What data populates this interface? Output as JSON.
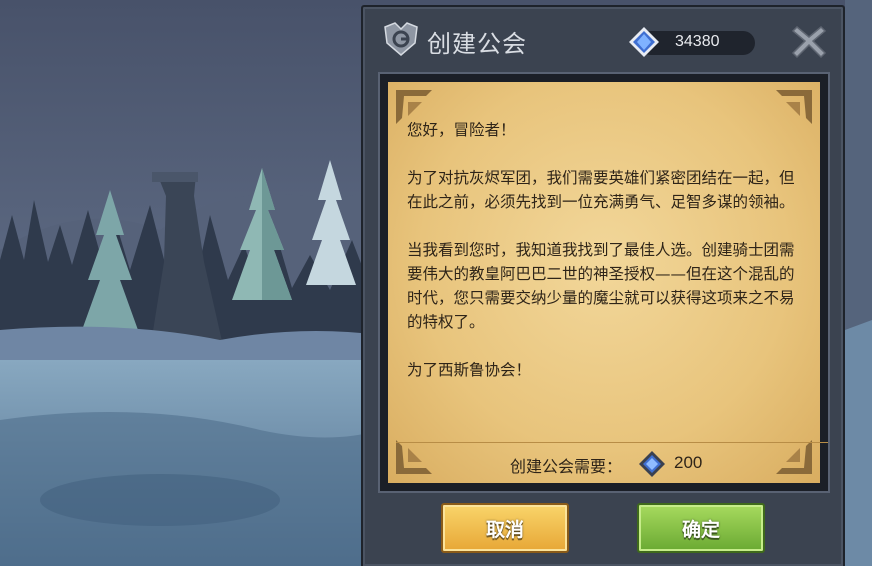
{
  "dialog": {
    "title": "创建公会",
    "currency": {
      "icon": "blue-gem-icon",
      "value": "34380"
    },
    "close_icon": "close-icon",
    "letter": {
      "greeting": "您好，冒险者！",
      "paragraph1": "为了对抗灰烬军团，我们需要英雄们紧密团结在一起，但在此之前，必须先找到一位充满勇气、足智多谋的领袖。",
      "paragraph2": "当我看到您时，我知道我找到了最佳人选。创建骑士团需要伟大的教皇阿巴巴二世的神圣授权——但在这个混乱的时代，您只需要交纳少量的魔尘就可以获得这项来之不易的特权了。",
      "closing": "为了西斯鲁协会！"
    },
    "requirement": {
      "label": "创建公会需要：",
      "icon": "blue-gem-icon",
      "value": "200"
    },
    "buttons": {
      "cancel": "取消",
      "confirm": "确定"
    }
  },
  "colors": {
    "panel": "#3b4350",
    "paper": "#ecc980",
    "cancel_button": "#f0bf4e",
    "confirm_button": "#86c046"
  }
}
